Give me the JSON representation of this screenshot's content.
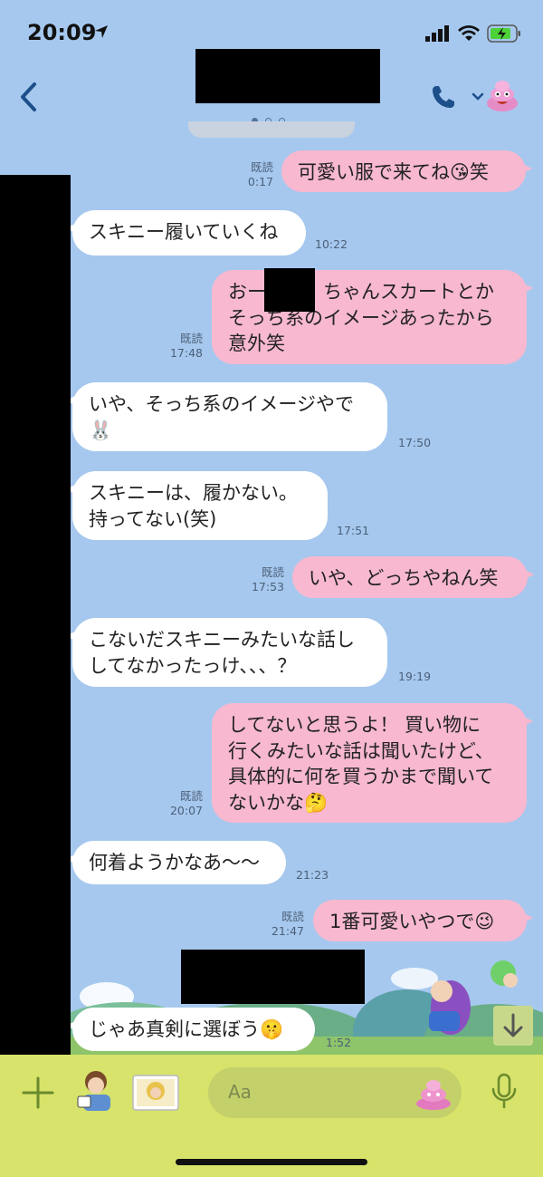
{
  "status_bar": {
    "time": "20:09"
  },
  "header": {
    "title": ""
  },
  "messages": [
    {
      "dir": "out",
      "text": "可愛い服で来てね😘笑",
      "read": "既読",
      "time": "0:17"
    },
    {
      "dir": "in",
      "text": "スキニー履いていくね",
      "time": "10:22"
    },
    {
      "dir": "out",
      "text": "おー　　　ちゃんスカートとか\nそっち系のイメージあったから\n意外笑",
      "read": "既読",
      "time": "17:48"
    },
    {
      "dir": "in",
      "text": "いや、そっち系のイメージやで\n🐰",
      "time": "17:50"
    },
    {
      "dir": "in",
      "text": "スキニーは、履かない。\n持ってない(笑)",
      "time": "17:51"
    },
    {
      "dir": "out",
      "text": "いや、どっちやねん笑",
      "read": "既読",
      "time": "17:53"
    },
    {
      "dir": "in",
      "text": "こないだスキニーみたいな話し\nしてなかったっけ、、、？",
      "time": "19:19"
    },
    {
      "dir": "out",
      "text": "してないと思うよ！ 買い物に\n行くみたいな話は聞いたけど、\n具体的に何を買うかまで聞いて\nないかな🤔",
      "read": "既読",
      "time": "20:07"
    },
    {
      "dir": "in",
      "text": "何着ようかなあ〜〜",
      "time": "21:23"
    },
    {
      "dir": "out",
      "text": "1番可愛いやつで😉",
      "read": "既読",
      "time": "21:47"
    },
    {
      "dir": "in",
      "text": "じゃあ真剣に選ぼう🤫",
      "time": "1:52"
    }
  ],
  "input": {
    "placeholder": "Aa"
  },
  "icons": {
    "back": "chevron-left-icon",
    "phone": "phone-icon",
    "mic": "mic-icon",
    "plus": "plus-icon",
    "down": "arrow-down-icon",
    "emoji": "emoji-icon"
  },
  "colors": {
    "background": "#a6c8ee",
    "outgoing_bubble": "#f7b8d0",
    "incoming_bubble": "#ffffff",
    "input_bar": "#d7e36a",
    "accent": "#1d4f8a"
  }
}
